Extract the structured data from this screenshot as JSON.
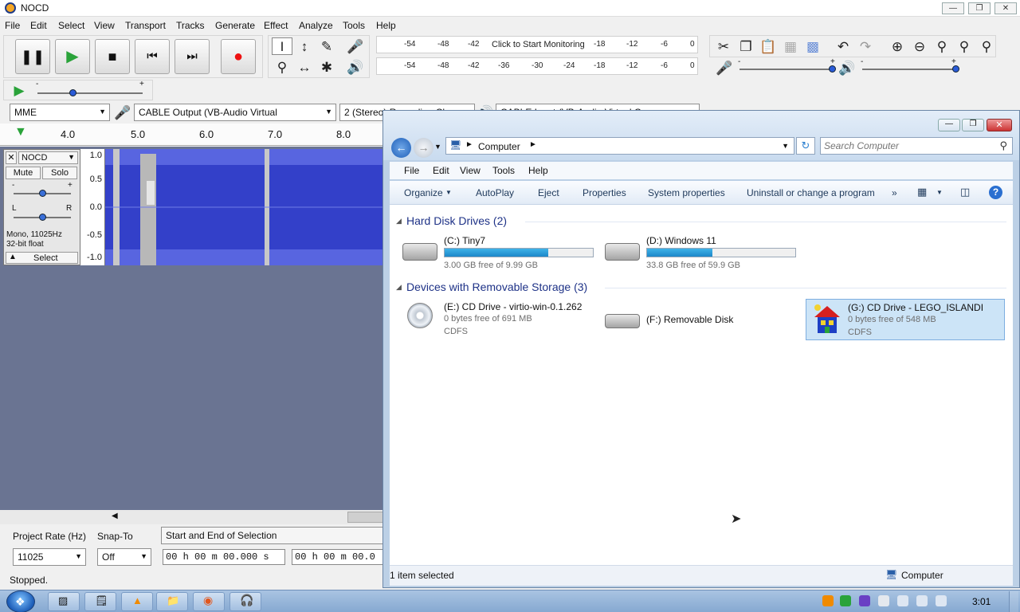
{
  "audacity": {
    "title": "NOCD",
    "menu": [
      "File",
      "Edit",
      "Select",
      "View",
      "Transport",
      "Tracks",
      "Generate",
      "Effect",
      "Analyze",
      "Tools",
      "Help"
    ],
    "meter_rec_ticks": [
      "-54",
      "-48",
      "-42",
      "Click to Start Monitoring",
      "-18",
      "-12",
      "-6",
      "0"
    ],
    "meter_play_ticks": [
      "-54",
      "-48",
      "-42",
      "-36",
      "-30",
      "-24",
      "-18",
      "-12",
      "-6",
      "0"
    ],
    "host": "MME",
    "rec_device": "CABLE Output (VB-Audio Virtual",
    "rec_channels": "2 (Stereo) Recording Ch",
    "play_device": "CABLE Input (VB-Audio Virtual C",
    "ruler": [
      "4.0",
      "5.0",
      "6.0",
      "7.0",
      "8.0"
    ],
    "track": {
      "name": "NOCD",
      "mute": "Mute",
      "solo": "Solo",
      "gain_minus": "-",
      "gain_plus": "+",
      "pan_left": "L",
      "pan_right": "R",
      "info1": "Mono, 11025Hz",
      "info2": "32-bit float",
      "select": "Select",
      "yaxis": [
        "1.0",
        "0.5",
        "0.0",
        "-0.5",
        "-1.0"
      ]
    },
    "project_rate_label": "Project Rate (Hz)",
    "project_rate": "11025",
    "snap_label": "Snap-To",
    "snap_value": "Off",
    "selection_mode": "Start and End of Selection",
    "time_start": "00 h 00 m 00.000 s",
    "time_end": "00 h 00 m 00.0",
    "status": "Stopped.",
    "colors": {
      "wave": "#3b4bd6",
      "track_bg": "#6a7492"
    }
  },
  "explorer": {
    "address": "Computer",
    "search_placeholder": "Search Computer",
    "menu": [
      "File",
      "Edit",
      "View",
      "Tools",
      "Help"
    ],
    "commands": [
      "Organize",
      "AutoPlay",
      "Eject",
      "Properties",
      "System properties",
      "Uninstall or change a program",
      "»"
    ],
    "groups": [
      {
        "title": "Hard Disk Drives (2)"
      },
      {
        "title": "Devices with Removable Storage (3)"
      }
    ],
    "drives": [
      {
        "name": "(C:) Tiny7",
        "free": "3.00 GB free of 9.99 GB",
        "used": 0.7
      },
      {
        "name": "(D:) Windows 11",
        "free": "33.8 GB free of 59.9 GB",
        "used": 0.44
      },
      {
        "name": "(E:) CD Drive - virtio-win-0.1.262",
        "free": "0 bytes free of 691 MB",
        "fs": "CDFS"
      },
      {
        "name": "(F:) Removable Disk"
      },
      {
        "name": "(G:) CD Drive - LEGO_ISLANDI",
        "free": "0 bytes free of 548 MB",
        "fs": "CDFS"
      }
    ],
    "status_left": "1 item selected",
    "status_right": "Computer",
    "colors": {
      "accent": "#1e3287",
      "selected": "#cce4f7"
    }
  },
  "taskbar": {
    "clock": "3:01"
  }
}
